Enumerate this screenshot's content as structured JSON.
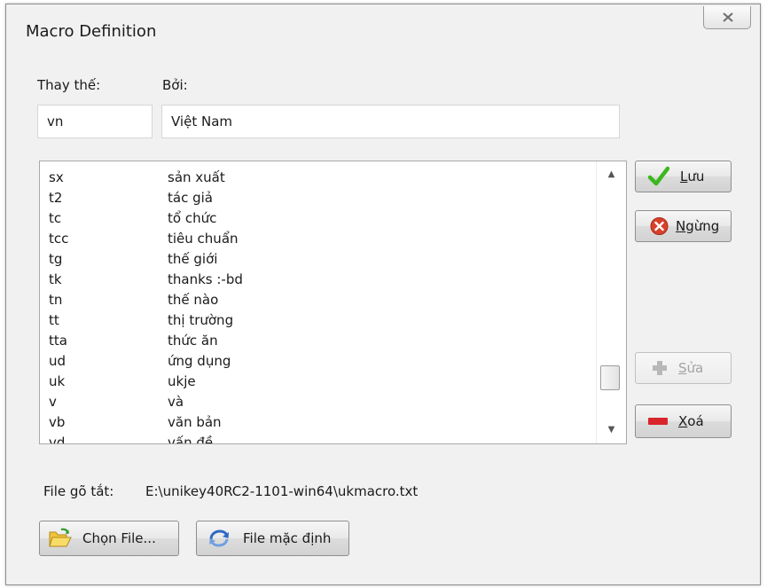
{
  "window": {
    "title": "Macro Definition"
  },
  "fields": {
    "replace_label": "Thay thế:",
    "by_label": "Bởi:",
    "replace_value": "vn",
    "by_value": "Việt Nam"
  },
  "list": {
    "rows": [
      {
        "key": "sx",
        "value": "sản xuất"
      },
      {
        "key": "t2",
        "value": "tác giả"
      },
      {
        "key": "tc",
        "value": "tổ chức"
      },
      {
        "key": "tcc",
        "value": "tiêu chuẩn"
      },
      {
        "key": "tg",
        "value": "thế giới"
      },
      {
        "key": "tk",
        "value": "thanks :-bd"
      },
      {
        "key": "tn",
        "value": "thế nào"
      },
      {
        "key": "tt",
        "value": "thị trường"
      },
      {
        "key": "tta",
        "value": "thức ăn"
      },
      {
        "key": "ud",
        "value": "ứng dụng"
      },
      {
        "key": "uk",
        "value": "ukje"
      },
      {
        "key": "v",
        "value": "và"
      },
      {
        "key": "vb",
        "value": "văn bản"
      },
      {
        "key": "vd",
        "value": "vấn đề"
      }
    ]
  },
  "buttons": {
    "save": {
      "mnemonic": "L",
      "rest": "ưu"
    },
    "stop": {
      "mnemonic": "N",
      "rest": "gừng"
    },
    "edit": {
      "mnemonic": "S",
      "rest": "ửa"
    },
    "delete": {
      "mnemonic": "X",
      "rest": "oá"
    },
    "choose_file": "Chọn File...",
    "default_file": "File mặc định"
  },
  "file": {
    "label": "File gõ tắt:",
    "path": "E:\\unikey40RC2-1101-win64\\ukmacro.txt"
  },
  "icons": {
    "save": "checkmark-icon",
    "stop": "stop-icon",
    "edit": "plus-icon",
    "delete": "minus-icon",
    "choose_file": "folder-open-icon",
    "default_file": "refresh-icon",
    "close": "close-icon"
  },
  "colors": {
    "check_green": "#3cb81e",
    "stop_red": "#d9402b",
    "delete_red": "#d8242a",
    "plus_gray": "#b8b8b8"
  }
}
